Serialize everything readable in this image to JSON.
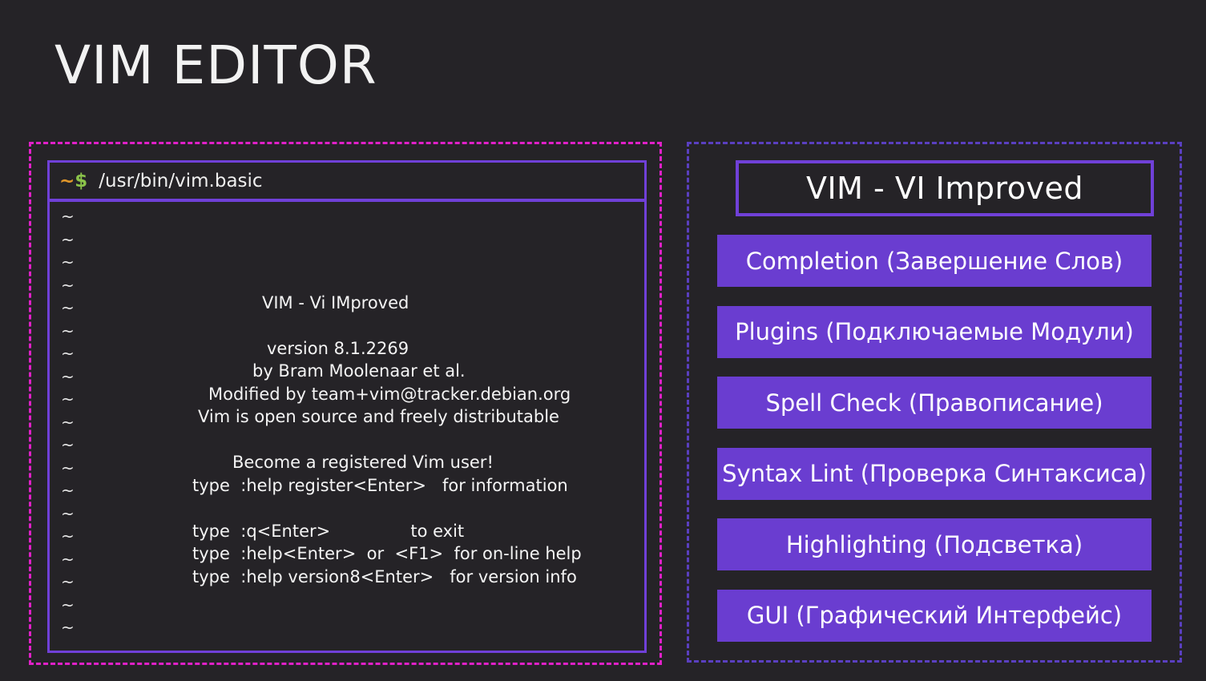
{
  "title": "VIM EDITOR",
  "terminal": {
    "prompt_tilde": "~",
    "prompt_dollar": "$",
    "command": "/usr/bin/vim.basic"
  },
  "editor": {
    "tilde": "~",
    "splash": {
      "name": "VIM - Vi IMproved",
      "version": "version 8.1.2269",
      "author": "by Bram Moolenaar et al.",
      "modified": "Modified by team+vim@tracker.debian.org",
      "license": "Vim is open source and freely distributable",
      "register": "Become a registered Vim user!",
      "register_help": "type  :help register<Enter>   for information",
      "exit_help": "type  :q<Enter>               to exit",
      "online_help": "type  :help<Enter>  or  <F1>  for on-line help",
      "version_help": "type  :help version8<Enter>   for version info"
    }
  },
  "sidebar": {
    "title": "VIM - VI Improved",
    "features": [
      "Completion (Завершение Слов)",
      "Plugins (Подключаемые Модули)",
      "Spell Check (Правописание)",
      "Syntax Lint (Проверка Синтаксиса)",
      "Highlighting (Подсветка)",
      "GUI (Графический Интерфейс)"
    ]
  },
  "colors": {
    "background": "#252327",
    "accent_magenta": "#e020c8",
    "accent_purple": "#6a3dd0",
    "prompt_tilde": "#e0962a",
    "prompt_dollar": "#8bc34a"
  }
}
